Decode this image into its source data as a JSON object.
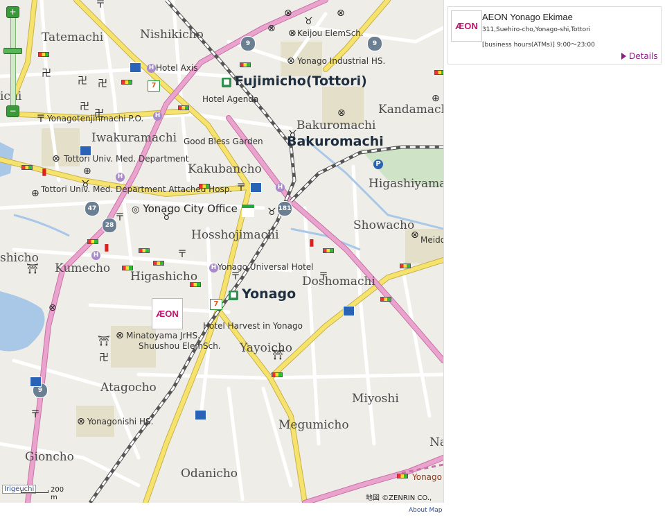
{
  "map": {
    "area_labels": {
      "tatemachi": "Tatemachi",
      "nishikicho": "Nishikicho",
      "kandamachi": "Kandamachi",
      "ichi": "ichi",
      "iwakuramachi": "Iwakuramachi",
      "bakuromachi_area": "Bakuromachi",
      "kakubancho": "Kakubancho",
      "higashiyama": "Higashiyama",
      "showacho": "Showacho",
      "hosshojimachi": "Hosshojimachi",
      "kumecho": "Kumecho",
      "shicho": "shicho",
      "higashicho": "Higashicho",
      "doshomachi": "Doshomachi",
      "yayoicho": "Yayoicho",
      "atagocho": "Atagocho",
      "miyoshi": "Miyoshi",
      "megumicho": "Megumicho",
      "gioncho": "Gioncho",
      "odanicho": "Odanicho",
      "na": "Na"
    },
    "station_labels": {
      "fujimicho": "Fujimicho(Tottori)",
      "bakuromachi_station": "Bakuromachi",
      "yonago": "Yonago"
    },
    "poi_labels": {
      "keijou": "Keijou ElemSch.",
      "yonago_industrial": "Yonago Industrial HS.",
      "hotel_axis": "Hotel Axis",
      "hotel_agenda": "Hotel Agenda",
      "yonagotenjinmachi": "Yonagotenjinmachi P.O.",
      "good_bless": "Good Bless Garden",
      "tottori_med": "Tottori Univ. Med. Department",
      "tottori_hosp": "Tottori Univ. Med. Department Attached Hosp.",
      "yonago_universal": "Yonago Universal Hotel",
      "hotel_harvest": "Hotel Harvest in Yonago",
      "minatoyama": "Minatoyama JrHS.",
      "shuushou": "Shuushou ElemSch.",
      "yonagonishi": "Yonagonishi HS.",
      "meido": "Meido",
      "yonago_edge": "Yonago",
      "irigeuchi": "Irigeuchi"
    },
    "landmark": "Yonago City Office",
    "route_shields": [
      "9",
      "9",
      "181",
      "47",
      "28",
      "9"
    ],
    "aeon_logo": "ÆON",
    "scale_label": "200 m",
    "copyright": "地図 ©ZENRIN CO., LTD.",
    "zoom_in": "+",
    "zoom_out": "−"
  },
  "info_panel": {
    "logo": "ÆON",
    "name": "AEON Yonago Ekimae",
    "address": "311,Suehiro-cho,Yonago-shi,Tottori",
    "hours": "[business hours(ATMs)]  9:00～23:00",
    "details_label": "Details"
  },
  "footer": {
    "about_map": "About Map"
  },
  "colors": {
    "map_bg": "#eeede8",
    "major_road": "#f5e36e",
    "national_road": "#e39ac8",
    "railway": "#666666",
    "river": "#a9c8e8",
    "park": "#d8e4c4",
    "accent": "#8b1c86"
  }
}
